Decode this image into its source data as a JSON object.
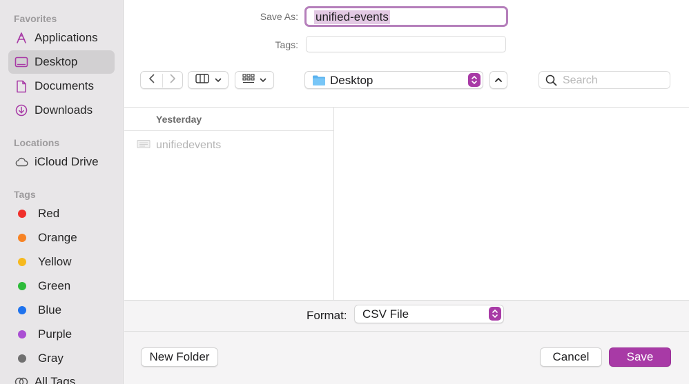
{
  "sidebar": {
    "favorites_header": "Favorites",
    "favorites": [
      {
        "label": "Applications",
        "icon": "applications-icon"
      },
      {
        "label": "Desktop",
        "icon": "desktop-icon",
        "selected": true
      },
      {
        "label": "Documents",
        "icon": "document-icon"
      },
      {
        "label": "Downloads",
        "icon": "downloads-icon"
      }
    ],
    "locations_header": "Locations",
    "locations": [
      {
        "label": "iCloud Drive",
        "icon": "cloud-icon"
      }
    ],
    "tags_header": "Tags",
    "tags": [
      {
        "label": "Red",
        "color": "#f0302b"
      },
      {
        "label": "Orange",
        "color": "#f78324"
      },
      {
        "label": "Yellow",
        "color": "#f6b91e"
      },
      {
        "label": "Green",
        "color": "#2dbb3a"
      },
      {
        "label": "Blue",
        "color": "#1f73ee"
      },
      {
        "label": "Purple",
        "color": "#aa4fd3"
      },
      {
        "label": "Gray",
        "color": "#707070"
      },
      {
        "label": "All Tags…",
        "icon": "all-tags-icon"
      }
    ]
  },
  "form": {
    "save_as_label": "Save As:",
    "save_as_value": "unified-events",
    "tags_label": "Tags:",
    "tags_value": ""
  },
  "toolbar": {
    "back_icon": "chevron-left-icon",
    "forward_icon": "chevron-right-icon",
    "view_icon": "column-view-icon",
    "group_icon": "grid-icon",
    "location": "Desktop",
    "search_placeholder": "Search"
  },
  "browser": {
    "group_header": "Yesterday",
    "files": [
      {
        "name": "unifiedevents",
        "icon": "file-icon",
        "enabled": false
      }
    ]
  },
  "bottom": {
    "format_label": "Format:",
    "format_value": "CSV File",
    "new_folder_label": "New Folder",
    "cancel_label": "Cancel",
    "save_label": "Save"
  },
  "colors": {
    "accent": "#a83aa6",
    "focus_ring": "#b57fbb",
    "selection": "#e3c9e4"
  }
}
